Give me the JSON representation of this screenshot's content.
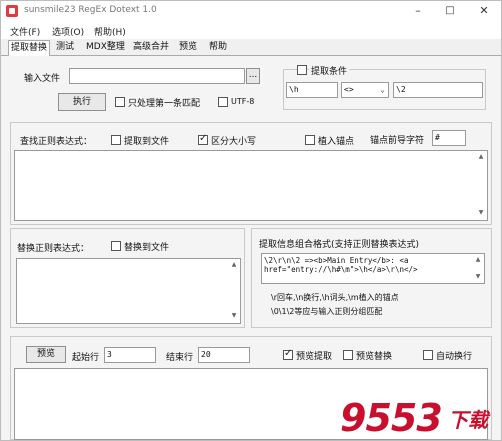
{
  "window": {
    "title": "sunsmile23 RegEx Dotext 1.0"
  },
  "menu": [
    "文件(F)",
    "选项(O)",
    "帮助(H)"
  ],
  "tabs": [
    "提取替换",
    "测试",
    "MDX整理",
    "高级合并",
    "预览",
    "帮助"
  ],
  "top": {
    "input_file_label": "输入文件",
    "input_file_value": "",
    "browse_label": "...",
    "execute_label": "执行",
    "first_match_label": "只处理第一条匹配",
    "utf8_label": "UTF-8",
    "extract_condition_label": "提取条件",
    "cond_left": "\\h",
    "cond_op": "<>",
    "cond_right": "\\2"
  },
  "find": {
    "label": "查找正则表达式：",
    "extract_to_file_label": "提取到文件",
    "case_label": "区分大小写",
    "insert_anchor_label": "植入锚点",
    "anchor_prefix_label": "锚点前导字符",
    "anchor_prefix_value": "#",
    "regex_value": ""
  },
  "replace": {
    "label": "替换正则表达式：",
    "replace_to_file_label": "替换到文件",
    "value": ""
  },
  "format": {
    "label": "提取信息组合格式(支持正则替换表达式)",
    "value": "\\2\\r\\n\\2 =><b>Main Entry</b>: <a\nhref=\"entry://\\h#\\m\">\\h</a>\\r\\n</>",
    "help1": "\\r回车,\\n换行,\\h词头,\\m植入的锚点",
    "help2": "\\0\\1\\2等应与输入正则分组匹配"
  },
  "preview": {
    "button_label": "预览",
    "start_label": "起始行",
    "start_value": "3",
    "end_label": "结束行",
    "end_value": "20",
    "preview_extract_label": "预览提取",
    "preview_replace_label": "预览替换",
    "auto_wrap_label": "自动换行"
  },
  "watermark": {
    "text": "9553",
    "sub": "下载"
  },
  "colors": {
    "watermark": "#c8102e",
    "selected_tab_bg": "#ffffff",
    "window_bg": "#f0f0f0"
  }
}
